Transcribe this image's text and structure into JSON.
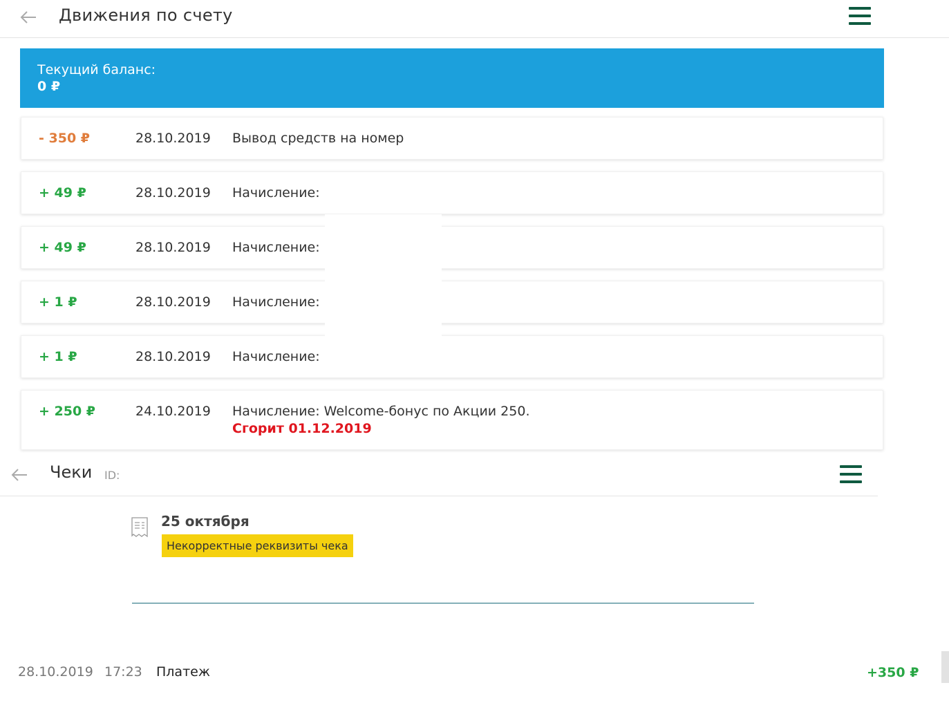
{
  "header": {
    "title": "Движения по счету"
  },
  "balance": {
    "label": "Текущий баланс:",
    "value": "0 ₽"
  },
  "transactions": [
    {
      "amount": "- 350 ₽",
      "date": "28.10.2019",
      "description": "Вывод средств на номер",
      "kind": "negative"
    },
    {
      "amount": "+ 49 ₽",
      "date": "28.10.2019",
      "description": "Начисление:",
      "kind": "positive"
    },
    {
      "amount": "+ 49 ₽",
      "date": "28.10.2019",
      "description": "Начисление:",
      "kind": "positive"
    },
    {
      "amount": "+ 1 ₽",
      "date": "28.10.2019",
      "description": "Начисление:",
      "kind": "positive"
    },
    {
      "amount": "+ 1 ₽",
      "date": "28.10.2019",
      "description": "Начисление:",
      "kind": "positive"
    },
    {
      "amount": "+ 250 ₽",
      "date": "24.10.2019",
      "description": "Начисление: Welcome-бонус по Акции 250.",
      "expiry": "Сгорит 01.12.2019",
      "kind": "positive"
    }
  ],
  "receipts_header": {
    "title": "Чеки",
    "id_label": "ID:"
  },
  "receipt": {
    "date": "25 октября",
    "status": "Некорректные реквизиты чека"
  },
  "payment": {
    "date": "28.10.2019",
    "time": "17:23",
    "type": "Платеж",
    "amount": "+350 ₽"
  },
  "colors": {
    "accent_blue": "#1ca0dc",
    "menu_green": "#0f5a40",
    "positive": "#28a745",
    "negative": "#e07d3c",
    "expiry_red": "#e0161f",
    "badge_yellow": "#f5d10f"
  },
  "icons": {
    "back": "arrow-left-icon",
    "menu": "hamburger-menu-icon",
    "receipt": "receipt-icon"
  }
}
